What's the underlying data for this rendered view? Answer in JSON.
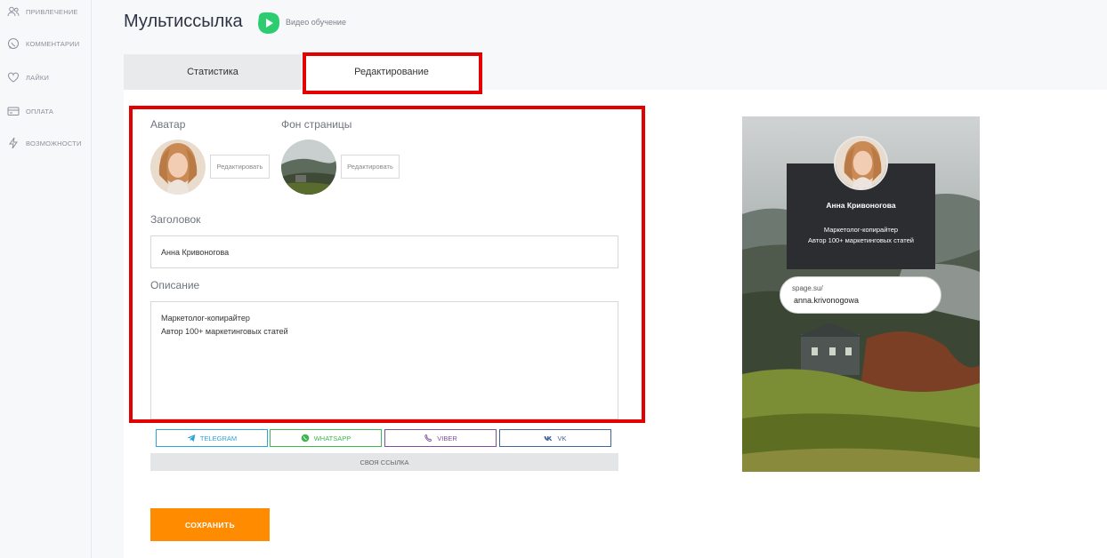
{
  "sidebar": {
    "items": [
      {
        "label": "ПРИВЛЕЧЕНИЕ",
        "icon": "users-icon"
      },
      {
        "label": "КОММЕНТАРИИ",
        "icon": "chat-icon"
      },
      {
        "label": "ЛАЙКИ",
        "icon": "heart-icon"
      },
      {
        "label": "ОПЛАТА",
        "icon": "card-icon"
      },
      {
        "label": "ВОЗМОЖНОСТИ",
        "icon": "lightning-icon"
      }
    ]
  },
  "header": {
    "title": "Мультиссылка",
    "video_label": "Видео обучение"
  },
  "tabs": [
    {
      "label": "Статистика",
      "active": false
    },
    {
      "label": "Редактирование",
      "active": true
    }
  ],
  "form": {
    "avatar_label": "Аватар",
    "background_label": "Фон страницы",
    "edit_button": "Редактировать",
    "title_label": "Заголовок",
    "title_value": "Анна Кривоногова",
    "description_label": "Описание",
    "description_lines": [
      "Маркетолог-копирайтер",
      "Автор 100+ маркетинговых статей"
    ]
  },
  "social_buttons": [
    {
      "label": "TELEGRAM",
      "color": "#2aa3d9"
    },
    {
      "label": "WHATSAPP",
      "color": "#3cb650"
    },
    {
      "label": "VIBER",
      "color": "#7d4f9c"
    },
    {
      "label": "VK",
      "color": "#3f6699"
    }
  ],
  "own_link_label": "СВОЯ ССЫЛКА",
  "save_label": "СОХРАНИТЬ",
  "preview": {
    "name": "Анна Кривоногова",
    "desc_lines": [
      "Маркетолог-копирайтер",
      "Автор 100+ маркетинговых статей"
    ],
    "link_domain": "spage.su/",
    "link_slug": "anna.krivonogowa"
  },
  "colors": {
    "accent_orange": "#ff8c00",
    "highlight_red": "#e30000",
    "video_green": "#2ecc71"
  }
}
